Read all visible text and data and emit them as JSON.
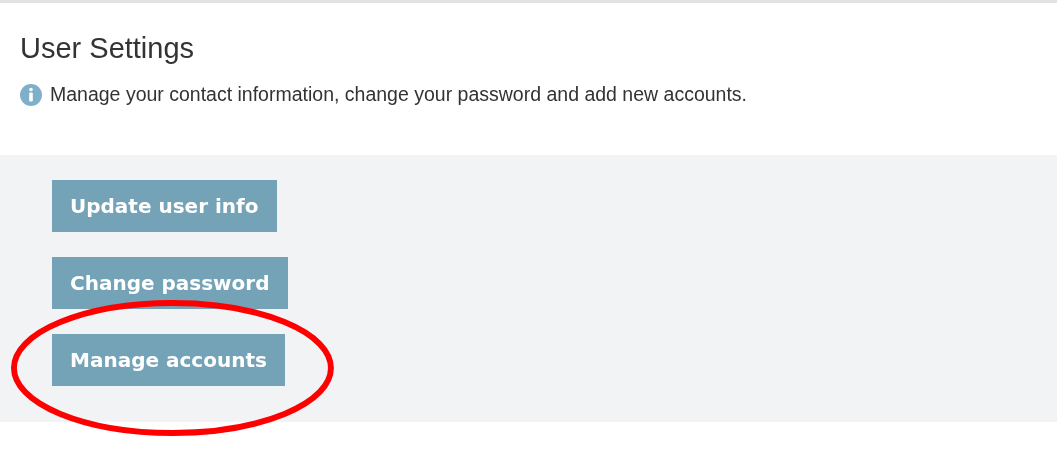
{
  "header": {
    "title": "User Settings",
    "description": "Manage your contact information, change your password and add new accounts."
  },
  "buttons": [
    {
      "label": "Update user info",
      "highlighted": false
    },
    {
      "label": "Change password",
      "highlighted": false
    },
    {
      "label": "Manage accounts",
      "highlighted": true
    }
  ]
}
